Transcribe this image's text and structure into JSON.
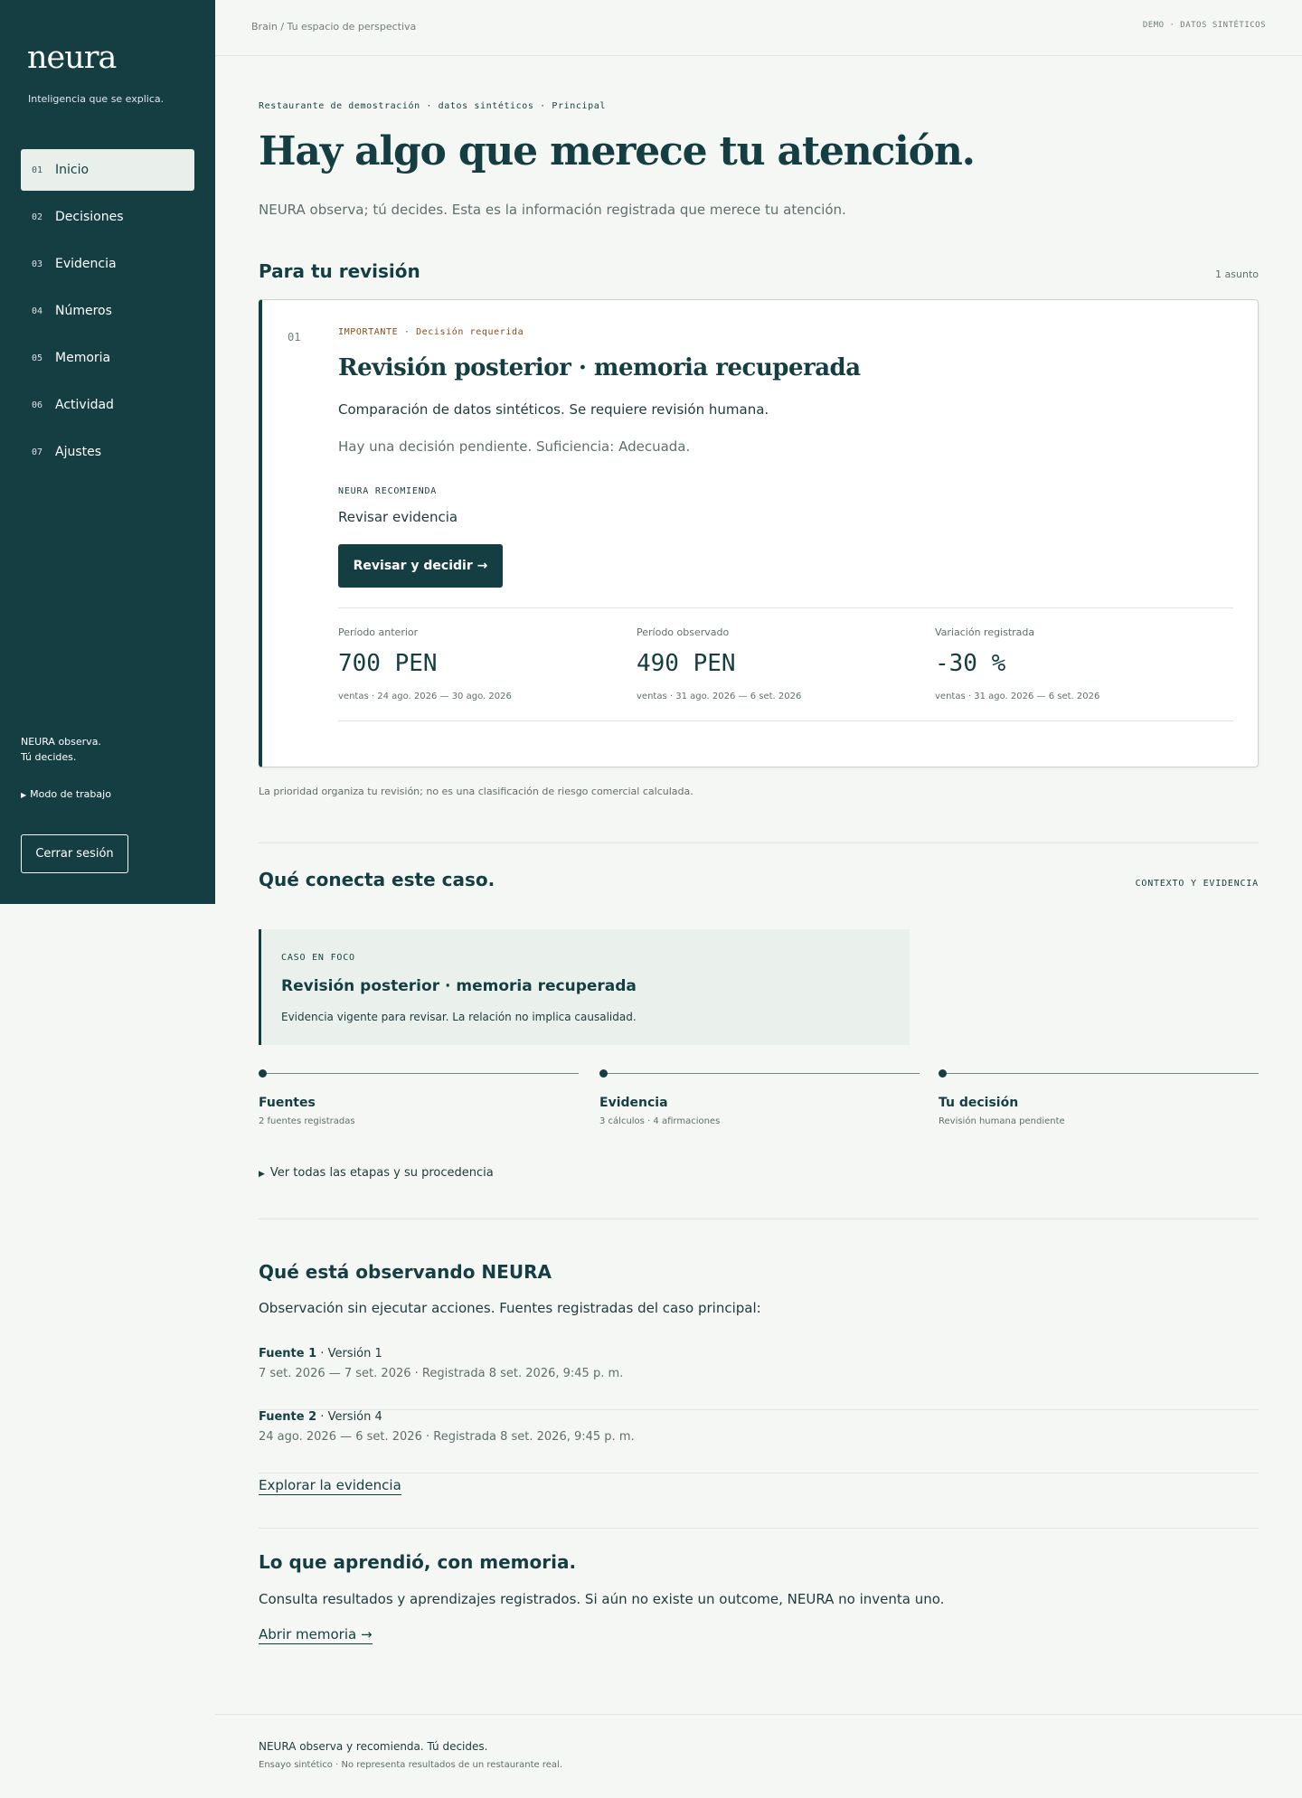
{
  "sidebar": {
    "brand": "neura",
    "tagline": "Inteligencia que se explica.",
    "items": [
      {
        "num": "01",
        "label": "Inicio",
        "active": true
      },
      {
        "num": "02",
        "label": "Decisiones"
      },
      {
        "num": "03",
        "label": "Evidencia"
      },
      {
        "num": "04",
        "label": "Números"
      },
      {
        "num": "05",
        "label": "Memoria"
      },
      {
        "num": "06",
        "label": "Actividad"
      },
      {
        "num": "07",
        "label": "Ajustes"
      }
    ],
    "note_line1": "NEURA observa.",
    "note_line2": "Tú decides.",
    "mode_label": "Modo de trabajo",
    "logout_label": "Cerrar sesión"
  },
  "topbar": {
    "breadcrumb": "Brain / Tu espacio de perspectiva",
    "demo_tag": "DEMO · DATOS SINTÉTICOS"
  },
  "hero": {
    "eyebrow": "Restaurante de demostración · datos sintéticos · Principal",
    "title": "Hay algo que merece tu atención.",
    "lead": "NEURA observa; tú decides. Esta es la información registrada que merece tu atención."
  },
  "review": {
    "title": "Para tu revisión",
    "count": "1 asunto",
    "card": {
      "num": "01",
      "priority": "IMPORTANTE · Decisión requerida",
      "title": "Revisión posterior · memoria recuperada",
      "description": "Comparación de datos sintéticos. Se requiere revisión humana.",
      "status": "Hay una decisión pendiente. Suficiencia: Adecuada.",
      "recommend_label": "NEURA RECOMIENDA",
      "recommend_action": "Revisar evidencia",
      "cta_label": "Revisar y decidir →",
      "metrics": [
        {
          "label": "Período anterior",
          "value": "700 PEN",
          "sub": "ventas · 24 ago. 2026 — 30 ago. 2026"
        },
        {
          "label": "Período observado",
          "value": "490 PEN",
          "sub": "ventas · 31 ago. 2026 — 6 set. 2026"
        },
        {
          "label": "Variación registrada",
          "value": "-30 %",
          "sub": "ventas · 31 ago. 2026 — 6 set. 2026"
        }
      ]
    },
    "note": "La prioridad organiza tu revisión; no es una clasificación de riesgo comercial calculada."
  },
  "context": {
    "title": "Qué conecta este caso.",
    "tag": "CONTEXTO Y EVIDENCIA",
    "focus_label": "CASO EN FOCO",
    "focus_title": "Revisión posterior · memoria recuperada",
    "focus_desc": "Evidencia vigente para revisar. La relación no implica causalidad.",
    "stages": [
      {
        "title": "Fuentes",
        "sub": "2 fuentes registradas"
      },
      {
        "title": "Evidencia",
        "sub": "3 cálculos · 4 afirmaciones"
      },
      {
        "title": "Tu decisión",
        "sub": "Revisión humana pendiente"
      }
    ],
    "expander": "Ver todas las etapas y su procedencia"
  },
  "observing": {
    "title": "Qué está observando NEURA",
    "subtitle": "Observación sin ejecutar acciones. Fuentes registradas del caso principal:",
    "sources": [
      {
        "name": "Fuente 1",
        "version": " · Versión 1",
        "dates": "7 set. 2026 — 7 set. 2026 · Registrada 8 set. 2026, 9:45 p. m."
      },
      {
        "name": "Fuente 2",
        "version": " · Versión 4",
        "dates": "24 ago. 2026 — 6 set. 2026 · Registrada 8 set. 2026, 9:45 p. m."
      }
    ],
    "link": "Explorar la evidencia"
  },
  "memory": {
    "title": "Lo que aprendió, con memoria.",
    "subtitle": "Consulta resultados y aprendizajes registrados. Si aún no existe un outcome, NEURA no inventa uno.",
    "link": "Abrir memoria →"
  },
  "footer": {
    "line1": "NEURA observa y recomienda. Tú decides.",
    "line2": "Ensayo sintético · No representa resultados de un restaurante real."
  }
}
